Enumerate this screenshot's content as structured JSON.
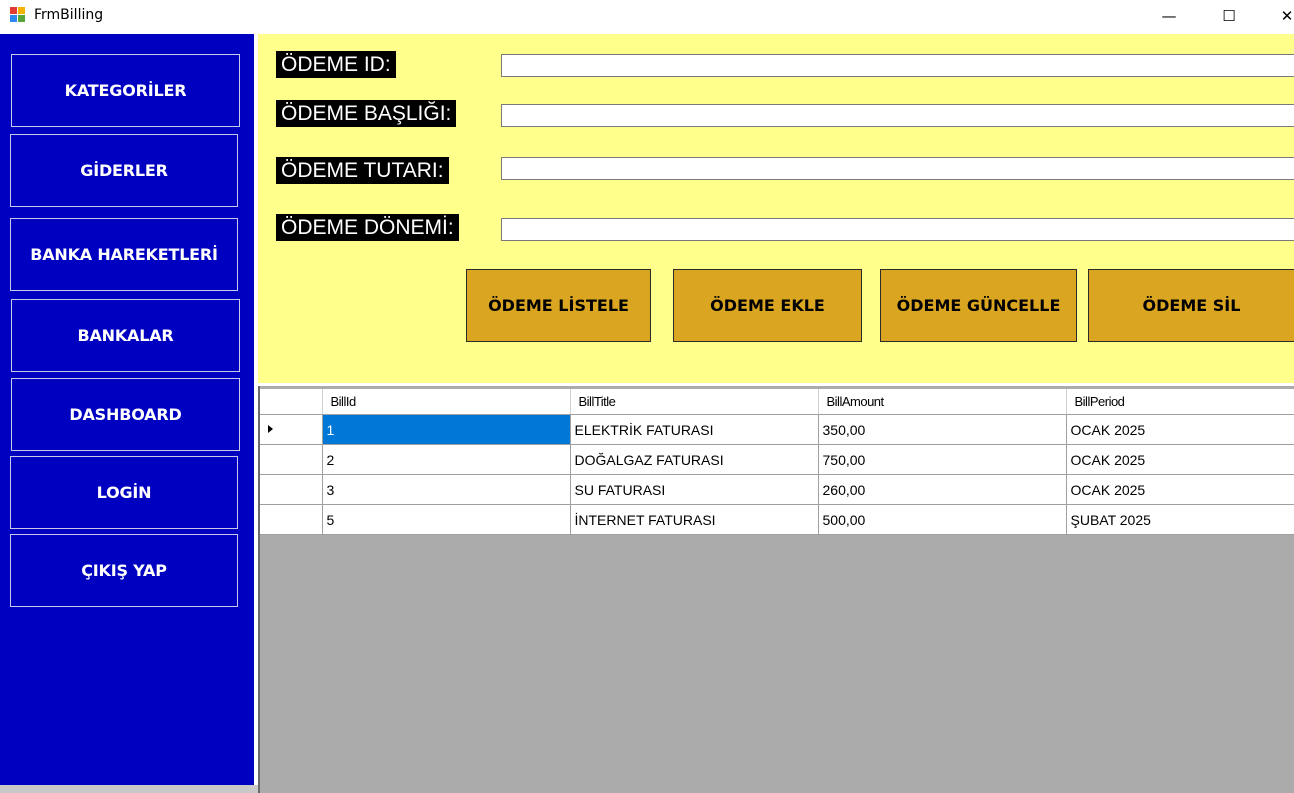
{
  "window": {
    "title": "FrmBilling",
    "min_symbol": "—",
    "max_symbol": "☐",
    "close_symbol": "✕"
  },
  "sidebar": {
    "items": [
      {
        "label": "KATEGORİLER"
      },
      {
        "label": "GİDERLER"
      },
      {
        "label": "BANKA HAREKETLERİ"
      },
      {
        "label": "BANKALAR"
      },
      {
        "label": "DASHBOARD"
      },
      {
        "label": "LOGİN"
      },
      {
        "label": "ÇIKIŞ YAP"
      }
    ]
  },
  "form": {
    "id_label": "ÖDEME ID:",
    "title_label": "ÖDEME BAŞLIĞI:",
    "amount_label": "ÖDEME TUTARI:",
    "period_label": "ÖDEME DÖNEMİ:",
    "id_value": "",
    "title_value": "",
    "amount_value": "",
    "period_value": ""
  },
  "actions": {
    "list_label": "ÖDEME LİSTELE",
    "add_label": "ÖDEME EKLE",
    "update_label": "ÖDEME GÜNCELLE",
    "delete_label": "ÖDEME SİL"
  },
  "grid": {
    "columns": [
      "BillId",
      "BillTitle",
      "BillAmount",
      "BillPeriod"
    ],
    "rows": [
      [
        "1",
        "ELEKTRİK FATURASI",
        "350,00",
        "OCAK 2025"
      ],
      [
        "2",
        "DOĞALGAZ FATURASI",
        "750,00",
        "OCAK 2025"
      ],
      [
        "3",
        "SU FATURASI",
        "260,00",
        "OCAK 2025"
      ],
      [
        "5",
        "İNTERNET FATURASI",
        "500,00",
        "ŞUBAT 2025"
      ]
    ]
  },
  "colors": {
    "sidebar_bg": "#0000c0",
    "form_bg": "#ffff8c",
    "button_bg": "#daa520",
    "grid_bg": "#ababab",
    "selection": "#0078d7"
  }
}
